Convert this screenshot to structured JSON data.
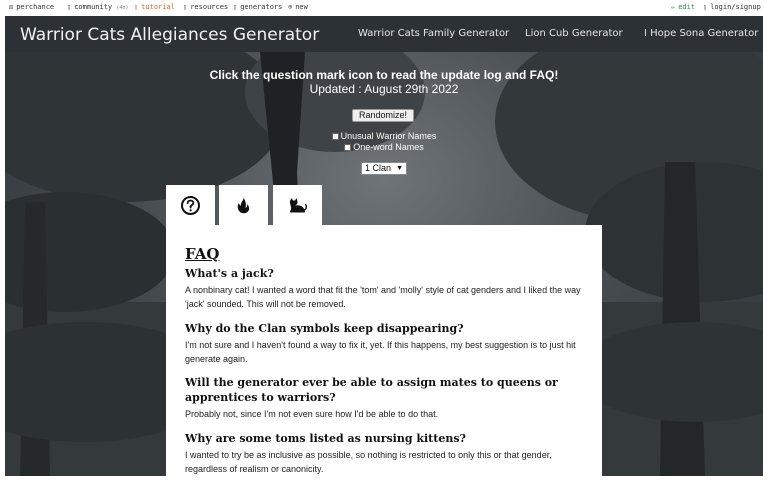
{
  "topbar": {
    "perchance": "perchance",
    "community": "community",
    "community_count": "(4h)",
    "tutorial": "tutorial",
    "resources": "resources",
    "generators": "generators",
    "new": "new",
    "edit": "edit",
    "login": "login/signup"
  },
  "navbar": {
    "title": "Warrior Cats Allegiances Generator",
    "links": [
      "Warrior Cats Family Generator",
      "Lion Cub Generator",
      "I Hope Sona Generator"
    ]
  },
  "controls": {
    "headline": "Click the question mark icon to read the update log and FAQ!",
    "updated": "Updated : August 29th 2022",
    "randomize_label": "Randomize!",
    "unusual_label": "Unusual Warrior Names",
    "oneword_label": "One-word Names",
    "clan_value": "1 Clan"
  },
  "tabs": [
    {
      "icon": "question-circle-icon"
    },
    {
      "icon": "flame-icon"
    },
    {
      "icon": "cat-icon"
    }
  ],
  "faq": {
    "title": "FAQ",
    "items": [
      {
        "q": "What's a jack?",
        "a": "A nonbinary cat! I wanted a word that fit the 'tom' and 'molly' style of cat genders and I liked the way 'jack' sounded. This will not be removed."
      },
      {
        "q": "Why do the Clan symbols keep disappearing?",
        "a": "I'm not sure and I haven't found a way to fix it, yet. If this happens, my best suggestion is to just hit generate again."
      },
      {
        "q": "Will the generator ever be able to assign mates to queens or apprentices to warriors?",
        "a": "Probably not, since I'm not even sure how I'd be able to do that."
      },
      {
        "q": "Why are some toms listed as nursing kittens?",
        "a": "I wanted to try be as inclusive as possible, so nothing is restricted to only this or that gender, regardless of realism or canonicity."
      }
    ]
  },
  "colors": {
    "navbar": "#2c3136",
    "tutorial": "#d2691e",
    "edit": "#2e8b57"
  }
}
